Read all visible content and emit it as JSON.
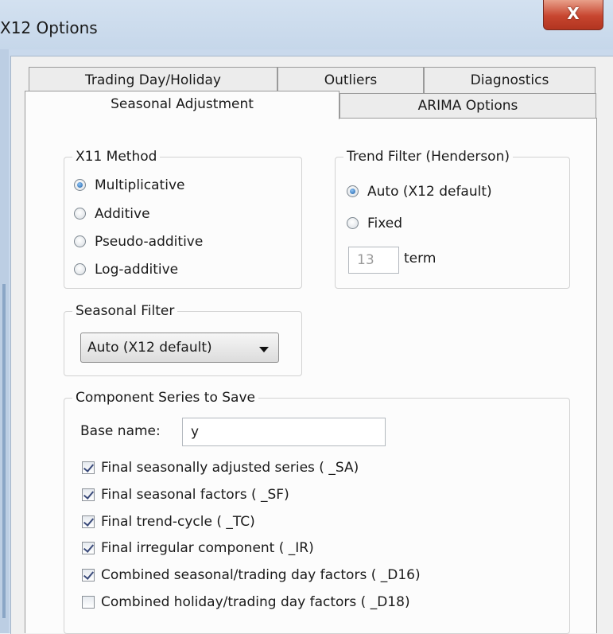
{
  "window": {
    "title": "X12 Options",
    "close_label": "X"
  },
  "tabs_back": [
    {
      "label": "Trading Day/Holiday"
    },
    {
      "label": "Outliers"
    },
    {
      "label": "Diagnostics"
    }
  ],
  "tabs_front": [
    {
      "label": "Seasonal Adjustment",
      "active": true
    },
    {
      "label": "ARIMA Options",
      "active": false
    }
  ],
  "x11_method": {
    "title": "X11 Method",
    "options": [
      "Multiplicative",
      "Additive",
      "Pseudo-additive",
      "Log-additive"
    ],
    "selected": "Multiplicative"
  },
  "trend_filter": {
    "title": "Trend Filter (Henderson)",
    "options": [
      "Auto (X12 default)",
      "Fixed"
    ],
    "selected": "Auto (X12 default)",
    "term_value": "13",
    "term_label": "term"
  },
  "seasonal_filter": {
    "title": "Seasonal Filter",
    "selected": "Auto (X12 default)"
  },
  "component_series": {
    "title": "Component Series to Save",
    "base_name_label": "Base name:",
    "base_name_value": "y",
    "items": [
      {
        "label": "Final seasonally adjusted series ( _SA)",
        "checked": true
      },
      {
        "label": "Final seasonal factors ( _SF)",
        "checked": true
      },
      {
        "label": "Final trend-cycle ( _TC)",
        "checked": true
      },
      {
        "label": "Final irregular component ( _IR)",
        "checked": true
      },
      {
        "label": "Combined seasonal/trading day factors ( _D16)",
        "checked": true
      },
      {
        "label": "Combined holiday/trading day factors ( _D18)",
        "checked": false
      }
    ]
  }
}
